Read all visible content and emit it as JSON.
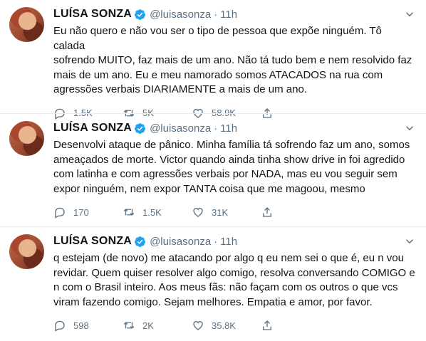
{
  "colors": {
    "text": "#0f1419",
    "muted": "#5b7083",
    "verified": "#1da1f2",
    "divider": "#e6ecf0"
  },
  "tweets": [
    {
      "name": "LUÍSA SONZA",
      "handle": "@luisasonza",
      "separator": "·",
      "time": "11h",
      "text": "Eu não quero e não vou ser o tipo de pessoa que expõe ninguém. Tô calada\nsofrendo MUITO, faz mais de um ano. Não tá tudo bem e nem resolvido faz\nmais de um ano.  Eu e meu namorado somos ATACADOS na rua com\nagressões verbais DIARIAMENTE a mais de um ano.",
      "replies": "1.5K",
      "retweets": "5K",
      "likes": "58.9K"
    },
    {
      "name": "LUÍSA SONZA",
      "handle": "@luisasonza",
      "separator": "·",
      "time": "11h",
      "text": "Desenvolvi ataque de pânico. Minha família tá sofrendo faz um ano, somos\nameaçados de morte. Victor quando ainda tinha show drive in foi agredido\ncom latinha e com agressões verbais por NADA, mas eu vou seguir sem\nexpor ninguém, nem expor TANTA coisa que me magoou, mesmo",
      "replies": "170",
      "retweets": "1.5K",
      "likes": "31K"
    },
    {
      "name": "LUÍSA SONZA",
      "handle": "@luisasonza",
      "separator": "·",
      "time": "11h",
      "text": "q estejam (de novo) me atacando por algo q eu nem sei o que é, eu n vou\nrevidar. Quem quiser resolver algo comigo, resolva conversando COMIGO e\nn com o Brasil inteiro. Aos meus fãs: não façam com os outros o que vcs\nviram fazendo comigo. Sejam melhores. Empatia e amor, por favor.",
      "replies": "598",
      "retweets": "2K",
      "likes": "35.8K"
    }
  ],
  "icons": {
    "verified": "verified-badge-icon",
    "more": "chevron-down-icon",
    "reply": "reply-icon",
    "retweet": "retweet-icon",
    "like": "heart-icon",
    "share": "share-icon"
  }
}
